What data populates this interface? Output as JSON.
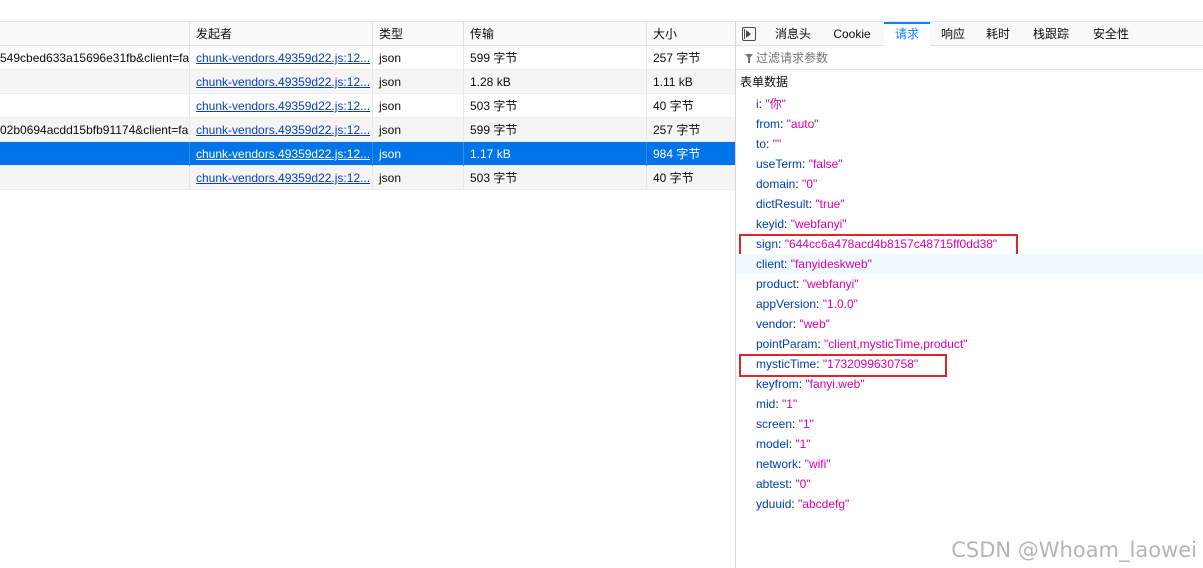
{
  "network": {
    "columns": [
      "",
      "发起者",
      "类型",
      "传输",
      "大小"
    ],
    "rows": [
      {
        "url": "549cbed633a15696e31fb&client=fa",
        "initiator": "chunk-vendors.49359d22.js:12...",
        "type": "json",
        "transferred": "599 字节",
        "size": "257 字节",
        "selected": false
      },
      {
        "url": "",
        "initiator": "chunk-vendors.49359d22.js:12...",
        "type": "json",
        "transferred": "1.28 kB",
        "size": "1.11 kB",
        "selected": false
      },
      {
        "url": "",
        "initiator": "chunk-vendors.49359d22.js:12...",
        "type": "json",
        "transferred": "503 字节",
        "size": "40 字节",
        "selected": false
      },
      {
        "url": "02b0694acdd15bfb91174&client=fa",
        "initiator": "chunk-vendors.49359d22.js:12...",
        "type": "json",
        "transferred": "599 字节",
        "size": "257 字节",
        "selected": false
      },
      {
        "url": "",
        "initiator": "chunk-vendors.49359d22.js:12...",
        "type": "json",
        "transferred": "1.17 kB",
        "size": "984 字节",
        "selected": true
      },
      {
        "url": "",
        "initiator": "chunk-vendors.49359d22.js:12...",
        "type": "json",
        "transferred": "503 字节",
        "size": "40 字节",
        "selected": false
      }
    ]
  },
  "detail": {
    "tabs": [
      "消息头",
      "Cookie",
      "请求",
      "响应",
      "耗时",
      "栈跟踪",
      "安全性"
    ],
    "active_tab": "请求",
    "filter_placeholder": "过滤请求参数",
    "section_title": "表单数据",
    "params": [
      {
        "key": "i",
        "value": "\"你\""
      },
      {
        "key": "from",
        "value": "\"auto\""
      },
      {
        "key": "to",
        "value": "\"\""
      },
      {
        "key": "useTerm",
        "value": "\"false\""
      },
      {
        "key": "domain",
        "value": "\"0\""
      },
      {
        "key": "dictResult",
        "value": "\"true\""
      },
      {
        "key": "keyid",
        "value": "\"webfanyi\""
      },
      {
        "key": "sign",
        "value": "\"644cc6a478acd4b8157c48715ff0dd38\"",
        "highlight": true
      },
      {
        "key": "client",
        "value": "\"fanyideskweb\"",
        "hover": true
      },
      {
        "key": "product",
        "value": "\"webfanyi\""
      },
      {
        "key": "appVersion",
        "value": "\"1.0.0\""
      },
      {
        "key": "vendor",
        "value": "\"web\""
      },
      {
        "key": "pointParam",
        "value": "\"client,mysticTime,product\""
      },
      {
        "key": "mysticTime",
        "value": "\"1732099630758\"",
        "highlight": true
      },
      {
        "key": "keyfrom",
        "value": "\"fanyi.web\""
      },
      {
        "key": "mid",
        "value": "\"1\""
      },
      {
        "key": "screen",
        "value": "\"1\""
      },
      {
        "key": "model",
        "value": "\"1\""
      },
      {
        "key": "network",
        "value": "\"wifi\""
      },
      {
        "key": "abtest",
        "value": "\"0\""
      },
      {
        "key": "yduuid",
        "value": "\"abcdefg\""
      }
    ]
  },
  "watermark": "CSDN @Whoam_laowei",
  "colors": {
    "selected_row": "#0074e8",
    "active_tab": "#0a84ff",
    "param_key": "#003eaa",
    "param_value": "#dd00a9",
    "highlight_box": "#e0252c"
  }
}
